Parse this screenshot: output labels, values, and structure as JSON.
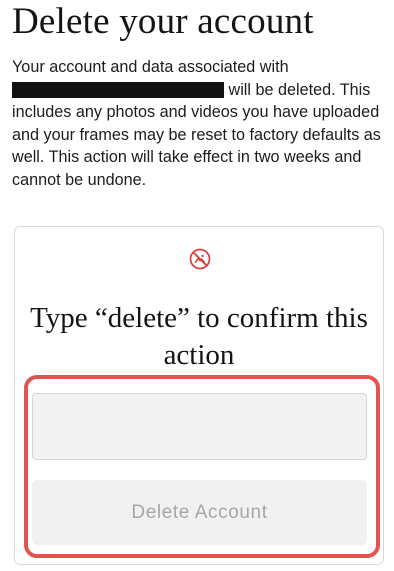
{
  "page": {
    "title": "Delete your account",
    "description_part1": "Your account and data associated with",
    "description_part2": " will be deleted. This includes any photos and videos you have uploaded and your frames may be reset to factory defaults as well. This action will take effect in two weeks and cannot be undone."
  },
  "confirm_card": {
    "icon": "no-photo-icon",
    "heading": "Type “delete” to confirm this action",
    "input_value": "",
    "input_placeholder": "",
    "button_label": "Delete Account"
  },
  "colors": {
    "accent_red": "#e35350",
    "icon_red": "#d94040",
    "disabled_text": "#a7a7a7",
    "field_bg": "#f2f3f2"
  }
}
